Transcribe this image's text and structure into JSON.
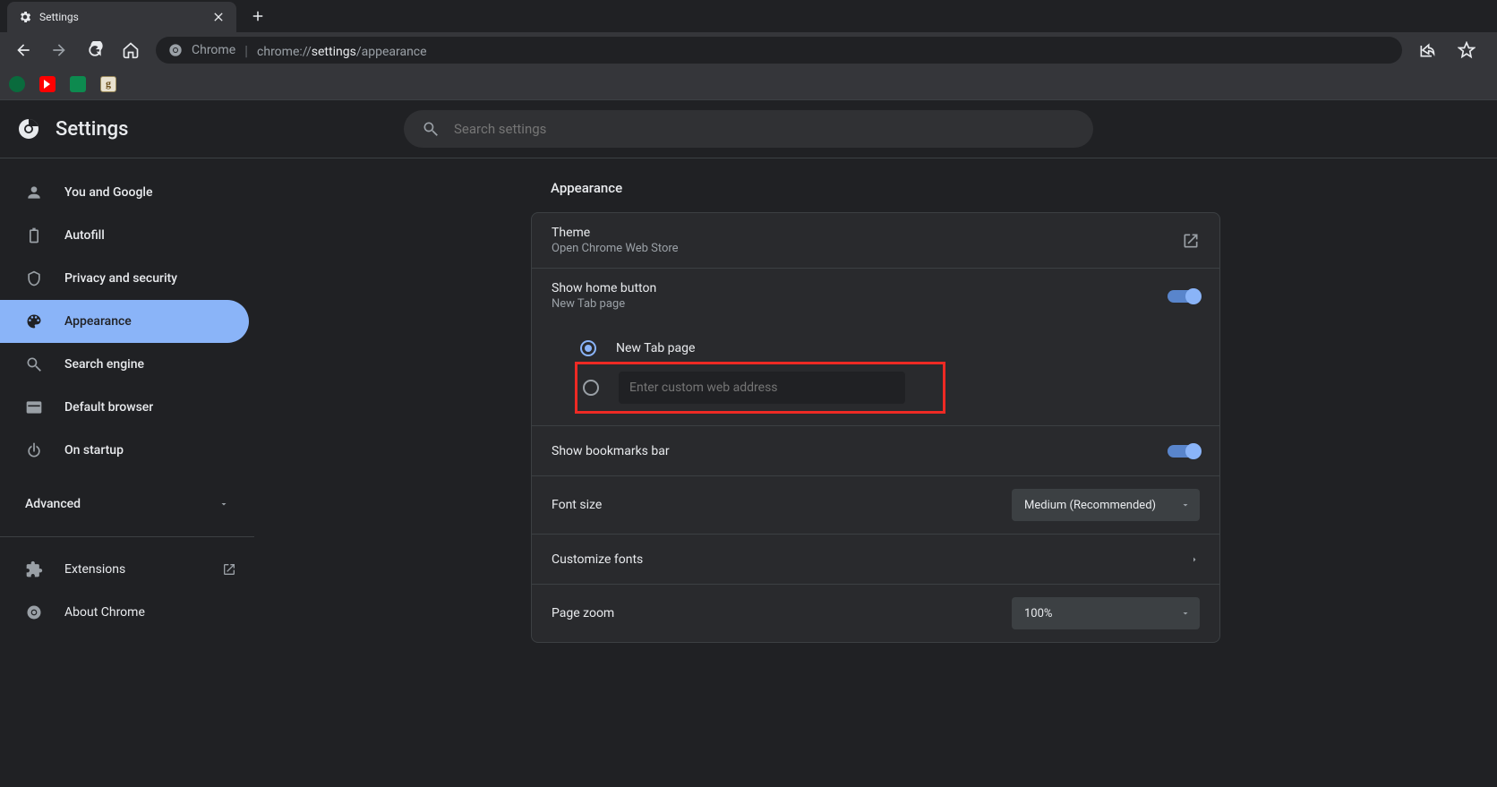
{
  "tab": {
    "title": "Settings"
  },
  "url": {
    "label": "Chrome",
    "scheme": "chrome://",
    "path_bold": "settings",
    "path_rest": "/appearance"
  },
  "header": {
    "title": "Settings"
  },
  "search": {
    "placeholder": "Search settings"
  },
  "sidebar": {
    "items": [
      {
        "label": "You and Google"
      },
      {
        "label": "Autofill"
      },
      {
        "label": "Privacy and security"
      },
      {
        "label": "Appearance"
      },
      {
        "label": "Search engine"
      },
      {
        "label": "Default browser"
      },
      {
        "label": "On startup"
      }
    ],
    "advanced": "Advanced",
    "footer": [
      {
        "label": "Extensions"
      },
      {
        "label": "About Chrome"
      }
    ]
  },
  "section": {
    "title": "Appearance"
  },
  "rows": {
    "theme": {
      "title": "Theme",
      "sub": "Open Chrome Web Store"
    },
    "home": {
      "title": "Show home button",
      "sub": "New Tab page",
      "radio1": "New Tab page",
      "radio2_placeholder": "Enter custom web address"
    },
    "bookmarks": {
      "title": "Show bookmarks bar"
    },
    "fontsize": {
      "title": "Font size",
      "value": "Medium (Recommended)"
    },
    "customfonts": {
      "title": "Customize fonts"
    },
    "zoom": {
      "title": "Page zoom",
      "value": "100%"
    }
  }
}
